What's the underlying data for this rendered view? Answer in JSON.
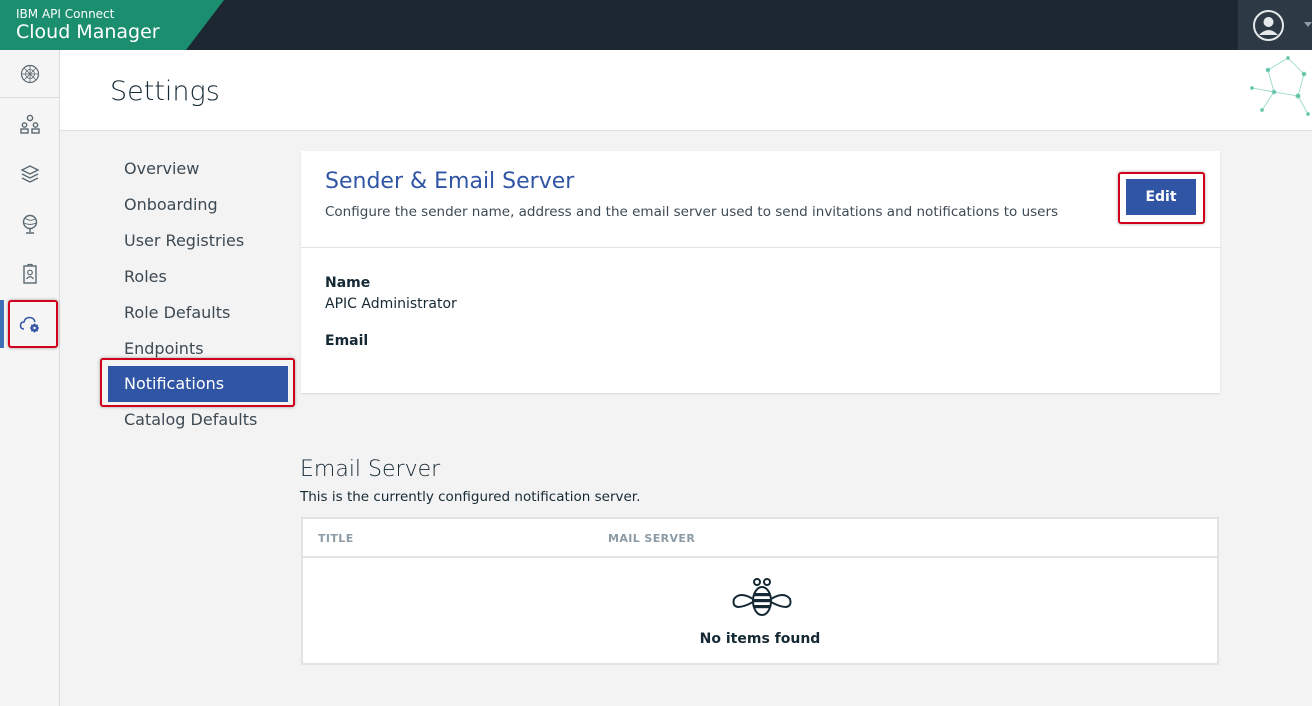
{
  "app": {
    "brand_line1": "IBM API Connect",
    "brand_line2": "Cloud Manager",
    "accent_color": "#1b8e6f",
    "primary_color": "#3155a5",
    "highlight_color": "#d0021b"
  },
  "rail": {
    "items": [
      {
        "name": "dashboard-icon",
        "active": false
      },
      {
        "name": "provider-organizations-icon",
        "active": false
      },
      {
        "name": "resources-icon",
        "active": false
      },
      {
        "name": "topology-icon",
        "active": false
      },
      {
        "name": "members-icon",
        "active": false
      },
      {
        "name": "cloud-settings-icon",
        "active": true
      }
    ]
  },
  "header": {
    "title": "Settings"
  },
  "settings_nav": {
    "items": [
      {
        "label": "Overview"
      },
      {
        "label": "Onboarding"
      },
      {
        "label": "User Registries"
      },
      {
        "label": "Roles"
      },
      {
        "label": "Role Defaults"
      },
      {
        "label": "Endpoints"
      },
      {
        "label": "Notifications",
        "selected": true
      },
      {
        "label": "Catalog Defaults"
      }
    ]
  },
  "sender_card": {
    "title": "Sender & Email Server",
    "description": "Configure the sender name, address and the email server used to send invitations and notifications to users",
    "edit_label": "Edit",
    "name_label": "Name",
    "name_value": "APIC Administrator",
    "email_label": "Email",
    "email_value": ""
  },
  "email_server": {
    "title": "Email Server",
    "description": "This is the currently configured notification server.",
    "columns": [
      "TITLE",
      "MAIL SERVER"
    ],
    "rows": [],
    "empty_text": "No items found"
  }
}
